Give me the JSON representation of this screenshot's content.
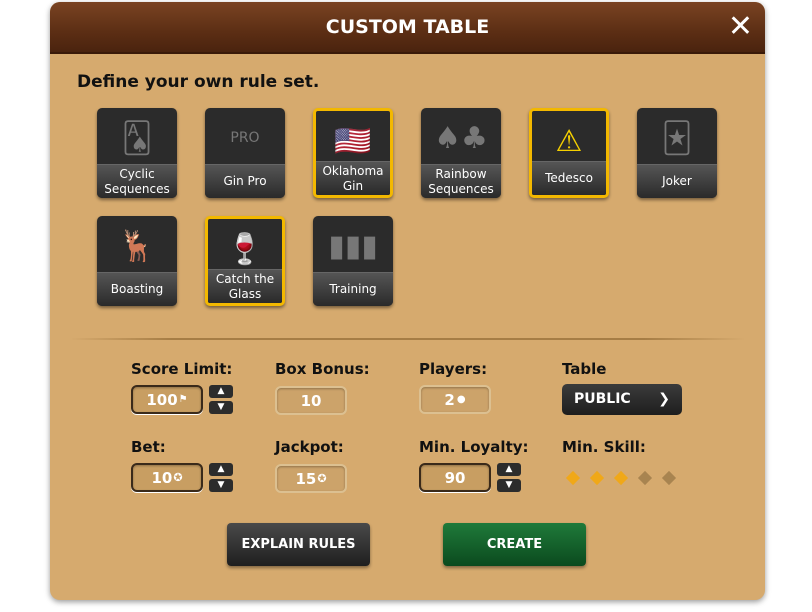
{
  "header": {
    "title": "CUSTOM TABLE",
    "close_icon": "close-icon"
  },
  "subtitle": "Define your own rule set.",
  "rules": [
    {
      "label": "Cyclic Sequences",
      "icon": "cycle-cards-icon",
      "selected": false
    },
    {
      "label": "Gin Pro",
      "icon": "laurel-pro-icon",
      "selected": false
    },
    {
      "label": "Oklahoma Gin",
      "icon": "us-flag-icon",
      "selected": true
    },
    {
      "label": "Rainbow Sequences",
      "icon": "rainbow-cards-icon",
      "selected": false
    },
    {
      "label": "Tedesco",
      "icon": "aces-warning-icon",
      "selected": true
    },
    {
      "label": "Joker",
      "icon": "jester-icon",
      "selected": false
    },
    {
      "label": "Boasting",
      "icon": "deer-icon",
      "selected": false
    },
    {
      "label": "Catch the Glass",
      "icon": "falling-glass-icon",
      "selected": true
    },
    {
      "label": "Training",
      "icon": "cards-icon",
      "selected": false
    }
  ],
  "form": {
    "score_limit": {
      "label": "Score Limit:",
      "value": "100",
      "unit_icon": "flag-icon"
    },
    "box_bonus": {
      "label": "Box Bonus:",
      "value": "10"
    },
    "players": {
      "label": "Players:",
      "value": "2",
      "unit_icon": "person-icon"
    },
    "table": {
      "label": "Table",
      "value": "PUBLIC"
    },
    "bet": {
      "label": "Bet:",
      "value": "10",
      "unit_icon": "chip-icon"
    },
    "jackpot": {
      "label": "Jackpot:",
      "value": "15",
      "unit_icon": "chip-icon"
    },
    "min_loyalty": {
      "label": "Min. Loyalty:",
      "value": "90"
    },
    "min_skill": {
      "label": "Min. Skill:",
      "value": 3,
      "max": 5,
      "active_color": "#f0a818",
      "inactive_color": "#a88450"
    }
  },
  "buttons": {
    "explain": "EXPLAIN RULES",
    "create": "CREATE"
  }
}
